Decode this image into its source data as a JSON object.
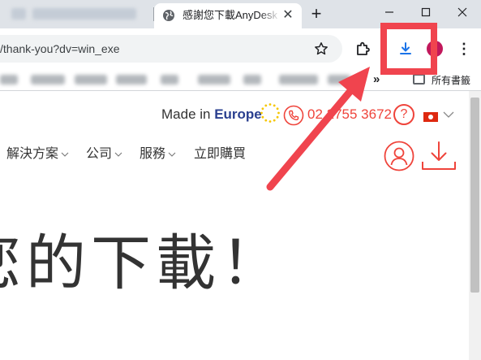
{
  "browser": {
    "active_tab": {
      "title": "感謝您下載AnyDesk"
    },
    "address_bar": {
      "url": "/thank-you?dv=win_exe"
    },
    "bookmarks_bar": {
      "more_chevron": "»",
      "all_bookmarks_label": "所有書籤"
    },
    "icons": {
      "new_tab": "plus-icon",
      "minimize": "minimize-icon",
      "maximize": "maximize-icon",
      "close": "close-icon",
      "bookmark_star": "star-icon",
      "extensions": "puzzle-icon",
      "downloads": "download-icon",
      "profile": "avatar",
      "menu": "kebab-menu-icon"
    },
    "colors": {
      "download_icon": "#1a73e8",
      "profile_avatar": "#c2185b"
    }
  },
  "page": {
    "top_bar": {
      "made_in_prefix": "Made in ",
      "made_in_region": "Europe",
      "phone": "02 2755 3672",
      "help_symbol": "?"
    },
    "nav": {
      "items": [
        {
          "label": "解決方案",
          "has_dropdown": true
        },
        {
          "label": "公司",
          "has_dropdown": true
        },
        {
          "label": "服務",
          "has_dropdown": true
        },
        {
          "label": "立即購買",
          "has_dropdown": false
        }
      ]
    },
    "headline": "您的下載！",
    "colors": {
      "brand_red": "#ef443b",
      "europe_blue": "#2a3f8f",
      "text_dark": "#333333"
    }
  },
  "annotation": {
    "type": "arrow-and-box",
    "target": "downloads-button",
    "color": "#f0444e"
  }
}
